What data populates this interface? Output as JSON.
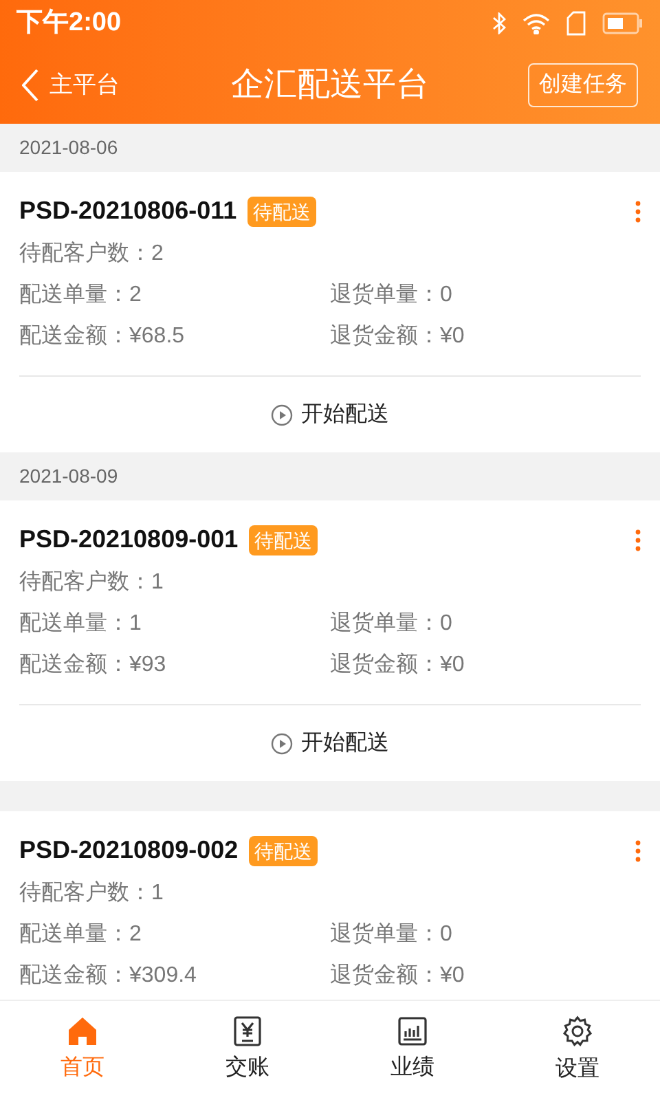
{
  "status_bar": {
    "time": "下午2:00"
  },
  "header": {
    "back_label": "主平台",
    "title": "企汇配送平台",
    "action": "创建任务"
  },
  "groups": [
    {
      "date": "2021-08-06",
      "order": {
        "id": "PSD-20210806-011",
        "status": "待配送",
        "rows": [
          [
            {
              "label": "待配客户数：",
              "value": "2"
            }
          ],
          [
            {
              "label": "配送单量：",
              "value": "2"
            },
            {
              "label": "退货单量：",
              "value": "0"
            }
          ],
          [
            {
              "label": "配送金额：",
              "value": "¥68.5"
            },
            {
              "label": "退货金额：",
              "value": "¥0"
            }
          ]
        ],
        "action": "开始配送"
      }
    },
    {
      "date": "2021-08-09",
      "order": {
        "id": "PSD-20210809-001",
        "status": "待配送",
        "rows": [
          [
            {
              "label": "待配客户数：",
              "value": "1"
            }
          ],
          [
            {
              "label": "配送单量：",
              "value": "1"
            },
            {
              "label": "退货单量：",
              "value": "0"
            }
          ],
          [
            {
              "label": "配送金额：",
              "value": "¥93"
            },
            {
              "label": "退货金额：",
              "value": "¥0"
            }
          ]
        ],
        "action": "开始配送"
      }
    },
    {
      "order": {
        "id": "PSD-20210809-002",
        "status": "待配送",
        "rows": [
          [
            {
              "label": "待配客户数：",
              "value": "1"
            }
          ],
          [
            {
              "label": "配送单量：",
              "value": "2"
            },
            {
              "label": "退货单量：",
              "value": "0"
            }
          ],
          [
            {
              "label": "配送金额：",
              "value": "¥309.4"
            },
            {
              "label": "退货金额：",
              "value": "¥0"
            }
          ]
        ]
      }
    }
  ],
  "tabs": [
    {
      "kind": "home",
      "label": "首页",
      "selected": true
    },
    {
      "kind": "ledger",
      "label": "交账",
      "selected": false
    },
    {
      "kind": "chart",
      "label": "业绩",
      "selected": false
    },
    {
      "kind": "settings",
      "label": "设置",
      "selected": false
    }
  ]
}
